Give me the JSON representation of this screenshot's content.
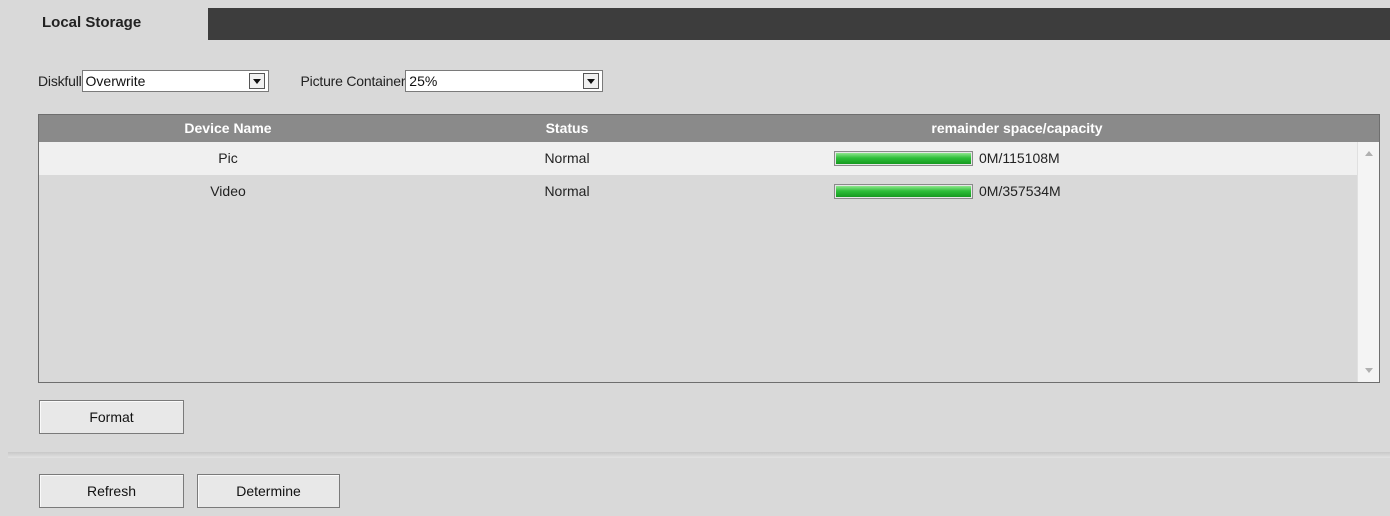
{
  "tab": {
    "label": "Local Storage"
  },
  "controls": {
    "diskfull_label": "Diskfull",
    "diskfull_value": "Overwrite",
    "picture_container_label": "Picture Container",
    "picture_container_value": "25%"
  },
  "table": {
    "columns": [
      "Device Name",
      "Status",
      "remainder space/capacity"
    ],
    "rows": [
      {
        "device": "Pic",
        "status": "Normal",
        "capacity": "0M/115108M",
        "used_fraction": 1.0
      },
      {
        "device": "Video",
        "status": "Normal",
        "capacity": "0M/357534M",
        "used_fraction": 1.0
      }
    ]
  },
  "buttons": {
    "format": "Format",
    "refresh": "Refresh",
    "determine": "Determine"
  },
  "colors": {
    "progress_fill": "#2fbf3a",
    "header_bg": "#8a8a8a",
    "tabbar_bg": "#3d3d3d"
  }
}
